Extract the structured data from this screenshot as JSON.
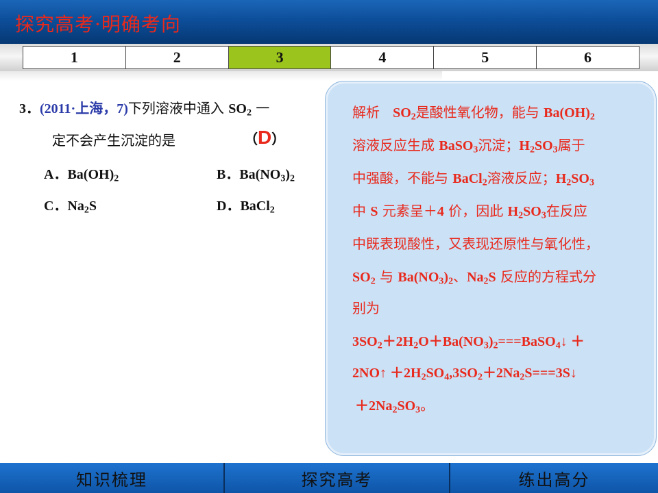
{
  "header": {
    "title": "探究高考·明确考向"
  },
  "tabs": [
    "1",
    "2",
    "3",
    "4",
    "5",
    "6"
  ],
  "active_tab": "3",
  "question": {
    "number": "3．",
    "source": "(2011·上海，7)",
    "text_1": "下列溶液中通入 ",
    "so2": "SO",
    "text_2": " 一",
    "text_3": "定不会产生沉淀的是",
    "paren_open": "（",
    "answer": "D",
    "paren_close": "）",
    "option_a_label": "A．",
    "option_a": "Ba(OH)",
    "option_b_label": "B．",
    "option_b": "Ba(NO",
    "option_c_label": "C．",
    "option_c": "Na",
    "option_d_label": "D．",
    "option_d": "BaCl"
  },
  "analysis": {
    "label": "解析",
    "l1_a": "SO",
    "l1_b": "是酸性氧化物，能与 ",
    "l1_c": "Ba(OH)",
    "l2_a": "溶液反应生成 ",
    "l2_b": "BaSO",
    "l2_c": "沉淀；",
    "l2_d": "H",
    "l2_e": "SO",
    "l2_f": "属于",
    "l3_a": "中强酸，不能与 ",
    "l3_b": "BaCl",
    "l3_c": "溶液反应；",
    "l3_d": "H",
    "l3_e": "SO",
    "l4_a": "中 ",
    "l4_b": "S",
    "l4_c": " 元素呈＋",
    "l4_d": "4",
    "l4_e": " 价，因此 ",
    "l4_f": "H",
    "l4_g": "SO",
    "l4_h": "在反应",
    "l5": "中既表现酸性，又表现还原性与氧化性，",
    "l6_a": "SO",
    "l6_b": "与 ",
    "l6_c": "Ba(NO",
    "l6_d": "、",
    "l6_e": "Na",
    "l6_f": "S",
    "l6_g": "反应的方程式分",
    "l7": "别为",
    "l8_a": "3SO",
    "l8_b": "＋2H",
    "l8_c": "O＋Ba(NO",
    "l8_d": "===BaSO",
    "l8_e": "↓ ＋",
    "l9_a": "2NO↑ ＋2H",
    "l9_b": "SO",
    "l9_c": ",3SO",
    "l9_d": "＋2Na",
    "l9_e": "S===3S↓",
    "l10_a": "＋2Na",
    "l10_b": "SO",
    "l10_c": "。"
  },
  "footer": [
    "知识梳理",
    "探究高考",
    "练出高分"
  ]
}
